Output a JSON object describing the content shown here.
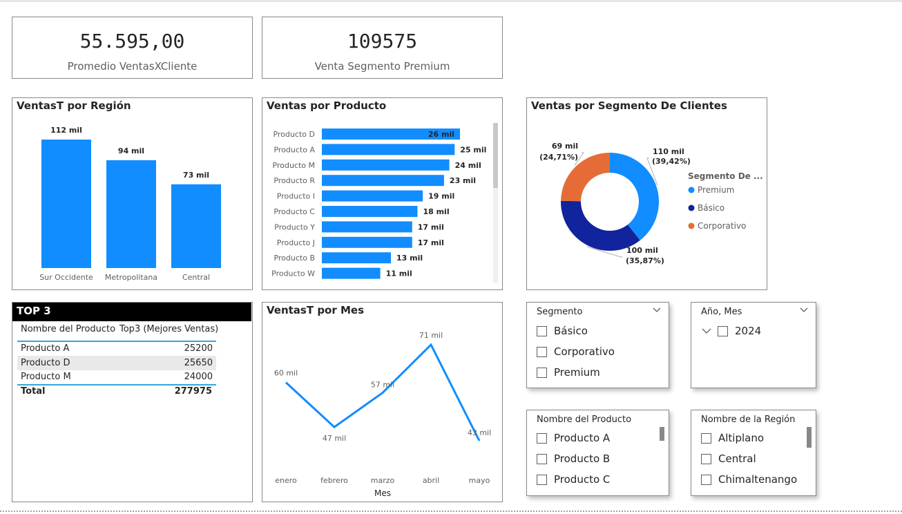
{
  "kpis": {
    "promedio": {
      "value": "55.595,00",
      "label": "Promedio VentasXCliente"
    },
    "premium": {
      "value": "109575",
      "label": "Venta Segmento Premium"
    }
  },
  "region_chart": {
    "title": "VentasT por Región",
    "bars": [
      {
        "category": "Sur Occidente",
        "value": 112,
        "label": "112 mil"
      },
      {
        "category": "Metropolitana",
        "value": 94,
        "label": "94 mil"
      },
      {
        "category": "Central",
        "value": 73,
        "label": "73 mil"
      }
    ],
    "color": "#118DFF"
  },
  "product_chart": {
    "title": "Ventas por Producto",
    "bars": [
      {
        "category": "Producto D",
        "value": 26,
        "label": "26 mil"
      },
      {
        "category": "Producto A",
        "value": 25,
        "label": "25 mil"
      },
      {
        "category": "Producto M",
        "value": 24,
        "label": "24 mil"
      },
      {
        "category": "Producto R",
        "value": 23,
        "label": "23 mil"
      },
      {
        "category": "Producto I",
        "value": 19,
        "label": "19 mil"
      },
      {
        "category": "Producto C",
        "value": 18,
        "label": "18 mil"
      },
      {
        "category": "Producto Y",
        "value": 17,
        "label": "17 mil"
      },
      {
        "category": "Producto J",
        "value": 17,
        "label": "17 mil"
      },
      {
        "category": "Producto B",
        "value": 13,
        "label": "13 mil"
      },
      {
        "category": "Producto W",
        "value": 11,
        "label": "11 mil"
      }
    ],
    "color": "#118DFF"
  },
  "segment_chart": {
    "title": "Ventas por Segmento De Clientes",
    "legend_title": "Segmento De ...",
    "slices": [
      {
        "name": "Premium",
        "value": 110,
        "percent": 39.42,
        "label_value": "110 mil",
        "label_pct": "(39,42%)",
        "color": "#118DFF"
      },
      {
        "name": "Básico",
        "value": 100,
        "percent": 35.87,
        "label_value": "100 mil",
        "label_pct": "(35,87%)",
        "color": "#12239E"
      },
      {
        "name": "Corporativo",
        "value": 69,
        "percent": 24.71,
        "label_value": "69 mil",
        "label_pct": "(24,71%)",
        "color": "#E66C37"
      }
    ]
  },
  "top3": {
    "title": "TOP 3",
    "headers": [
      "Nombre del Producto",
      "Top3 (Mejores Ventas)"
    ],
    "rows": [
      {
        "name": "Producto A",
        "value": "25200"
      },
      {
        "name": "Producto D",
        "value": "25650"
      },
      {
        "name": "Producto M",
        "value": "24000"
      }
    ],
    "total_label": "Total",
    "total_value": "277975"
  },
  "month_chart": {
    "title": "VentasT por Mes",
    "xlabel": "Mes",
    "points": [
      {
        "month": "enero",
        "value": 60,
        "label": "60 mil"
      },
      {
        "month": "febrero",
        "value": 47,
        "label": "47 mil"
      },
      {
        "month": "marzo",
        "value": 57,
        "label": "57 mil"
      },
      {
        "month": "abril",
        "value": 71,
        "label": "71 mil"
      },
      {
        "month": "mayo",
        "value": 43,
        "label": "43 mil"
      }
    ],
    "color": "#118DFF"
  },
  "chart_data": [
    {
      "type": "bar",
      "title": "VentasT por Región",
      "categories": [
        "Sur Occidente",
        "Metropolitana",
        "Central"
      ],
      "values": [
        112,
        94,
        73
      ],
      "unit": "mil"
    },
    {
      "type": "bar",
      "orientation": "horizontal",
      "title": "Ventas por Producto",
      "categories": [
        "Producto D",
        "Producto A",
        "Producto M",
        "Producto R",
        "Producto I",
        "Producto C",
        "Producto Y",
        "Producto J",
        "Producto B",
        "Producto W"
      ],
      "values": [
        26,
        25,
        24,
        23,
        19,
        18,
        17,
        17,
        13,
        11
      ],
      "unit": "mil"
    },
    {
      "type": "pie",
      "title": "Ventas por Segmento De Clientes",
      "categories": [
        "Premium",
        "Básico",
        "Corporativo"
      ],
      "values": [
        110,
        100,
        69
      ],
      "percents": [
        39.42,
        35.87,
        24.71
      ],
      "unit": "mil"
    },
    {
      "type": "line",
      "title": "VentasT por Mes",
      "xlabel": "Mes",
      "x": [
        "enero",
        "febrero",
        "marzo",
        "abril",
        "mayo"
      ],
      "values": [
        60,
        47,
        57,
        71,
        43
      ],
      "unit": "mil"
    }
  ],
  "slicers": {
    "segmento": {
      "title": "Segmento",
      "items": [
        "Básico",
        "Corporativo",
        "Premium"
      ]
    },
    "anio_mes": {
      "title": "Año, Mes",
      "items": [
        "2024"
      ]
    },
    "producto": {
      "title": "Nombre del Producto",
      "items": [
        "Producto A",
        "Producto B",
        "Producto C"
      ]
    },
    "region": {
      "title": "Nombre de la Región",
      "items": [
        "Altiplano",
        "Central",
        "Chimaltenango"
      ]
    }
  }
}
